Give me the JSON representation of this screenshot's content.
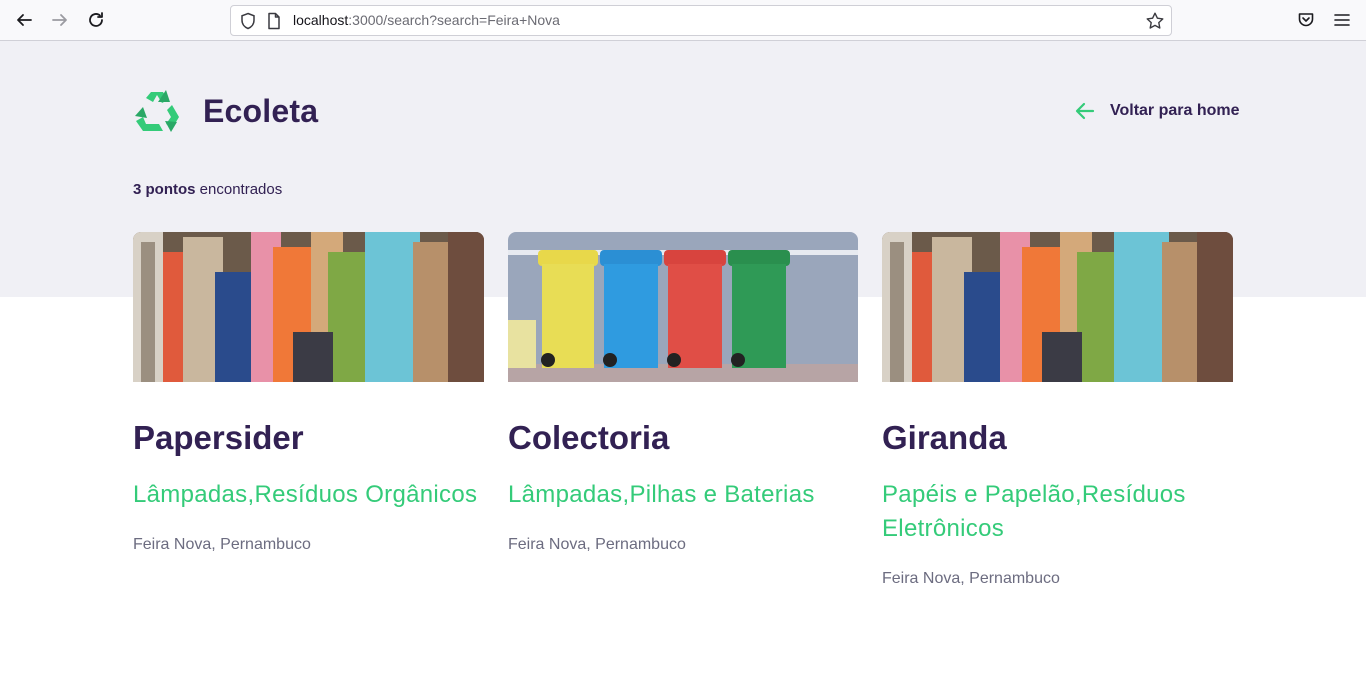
{
  "browser": {
    "url_host": "localhost",
    "url_rest": ":3000/search?search=Feira+Nova"
  },
  "header": {
    "logo_text": "Ecoleta",
    "back_home_label": "Voltar para home"
  },
  "results": {
    "count": "3 pontos",
    "suffix": " encontrados"
  },
  "cards": [
    {
      "name": "Papersider",
      "items": "Lâmpadas,Resíduos Orgânicos",
      "location": "Feira Nova, Pernambuco",
      "image": "paper-waste"
    },
    {
      "name": "Colectoria",
      "items": "Lâmpadas,Pilhas e Baterias",
      "location": "Feira Nova, Pernambuco",
      "image": "recycling-bins"
    },
    {
      "name": "Giranda",
      "items": "Papéis e Papelão,Resíduos Eletrônicos",
      "location": "Feira Nova, Pernambuco",
      "image": "paper-waste"
    }
  ],
  "colors": {
    "primary": "#322153",
    "accent": "#34cb79",
    "background": "#f0f0f5",
    "muted_text": "#6c6c80"
  }
}
